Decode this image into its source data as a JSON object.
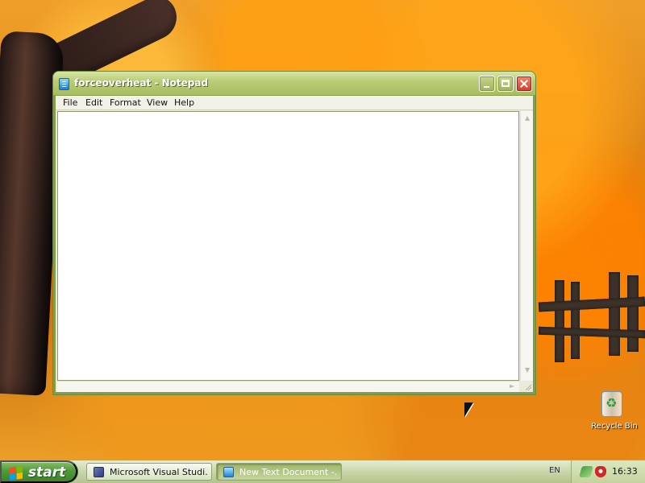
{
  "window": {
    "title": "forceoverheat - Notepad",
    "app_icon": "notepad-icon",
    "menu": [
      {
        "label": "File"
      },
      {
        "label": "Edit"
      },
      {
        "label": "Format"
      },
      {
        "label": "View"
      },
      {
        "label": "Help"
      }
    ],
    "text_content": ""
  },
  "desktop": {
    "icons": [
      {
        "label": "Recycle Bin",
        "icon": "recycle-bin-icon"
      }
    ],
    "cursor": "arrow-cursor-icon"
  },
  "taskbar": {
    "start_label": "start",
    "tasks": [
      {
        "label": "Microsoft Visual Studi...",
        "icon": "visual-studio-icon",
        "active": false
      },
      {
        "label": "New Text Document -...",
        "icon": "notepad-icon",
        "active": true
      }
    ],
    "language": "EN",
    "tray_icons": [
      "network-icon",
      "security-shield-icon"
    ],
    "clock": "16:33"
  },
  "colors": {
    "window_border": "#7f9e47",
    "titlebar_green": "#b8cc75",
    "taskbar_green": "#c7d4a7",
    "start_green": "#4f9b39",
    "close_red": "#d6392e"
  }
}
